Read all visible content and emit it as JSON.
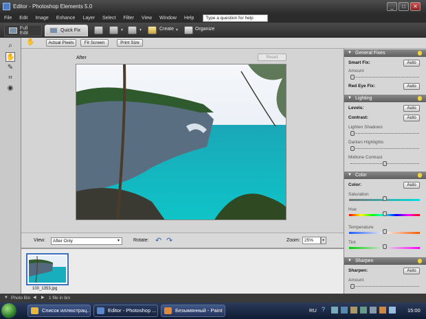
{
  "window": {
    "title": "Editor - Photoshop Elements 5.0"
  },
  "menu": {
    "items": [
      "File",
      "Edit",
      "Image",
      "Enhance",
      "Layer",
      "Select",
      "Filter",
      "View",
      "Window",
      "Help"
    ],
    "help_placeholder": "Type a question for help"
  },
  "toolbar": {
    "full_edit": "Full Edit",
    "quick_fix": "Quick Fix",
    "create": "Create",
    "organize": "Organize"
  },
  "options": {
    "actual_pixels": "Actual Pixels",
    "fit_screen": "Fit Screen",
    "print_size": "Print Size"
  },
  "canvas": {
    "label": "After",
    "reset": "Reset"
  },
  "viewbar": {
    "view_label": "View:",
    "view_value": "After Only",
    "rotate_label": "Rotate:",
    "zoom_label": "Zoom:",
    "zoom_value": "25%"
  },
  "bin": {
    "thumb_caption": "100_1353.jpg"
  },
  "panels": {
    "general_fixes": {
      "title": "General Fixes",
      "smart_fix": "Smart Fix:",
      "amount": "Amount",
      "red_eye": "Red Eye Fix:",
      "auto": "Auto",
      "amount_level": 0.0
    },
    "lighting": {
      "title": "Lighting",
      "levels": "Levels:",
      "contrast": "Contrast:",
      "lighten_shadows": "Lighten Shadows",
      "darken_highlights": "Darken Highlights",
      "midtone_contrast": "Midtone Contrast",
      "auto": "Auto",
      "lighten_level": 0.0,
      "darken_level": 0.0,
      "midtone_level": 0.5
    },
    "color": {
      "title": "Color",
      "color": "Color:",
      "saturation": "Saturation",
      "hue": "Hue",
      "temperature": "Temperature",
      "tint": "Tint",
      "auto": "Auto",
      "saturation_level": 0.5,
      "hue_level": 0.5,
      "temperature_level": 0.5,
      "tint_level": 0.5
    },
    "sharpen": {
      "title": "Sharpen",
      "sharpen": "Sharpen:",
      "amount": "Amount",
      "auto": "Auto",
      "amount_level": 0.0
    }
  },
  "status": {
    "photo_bin": "Photo Bin",
    "files": "1 file in bin"
  },
  "taskbar": {
    "task1": "Список иллюстрац...",
    "task2": "Editor - Photoshop ...",
    "task3": "Безымянный - Paint",
    "lang": "RU",
    "clock": "15:00"
  }
}
